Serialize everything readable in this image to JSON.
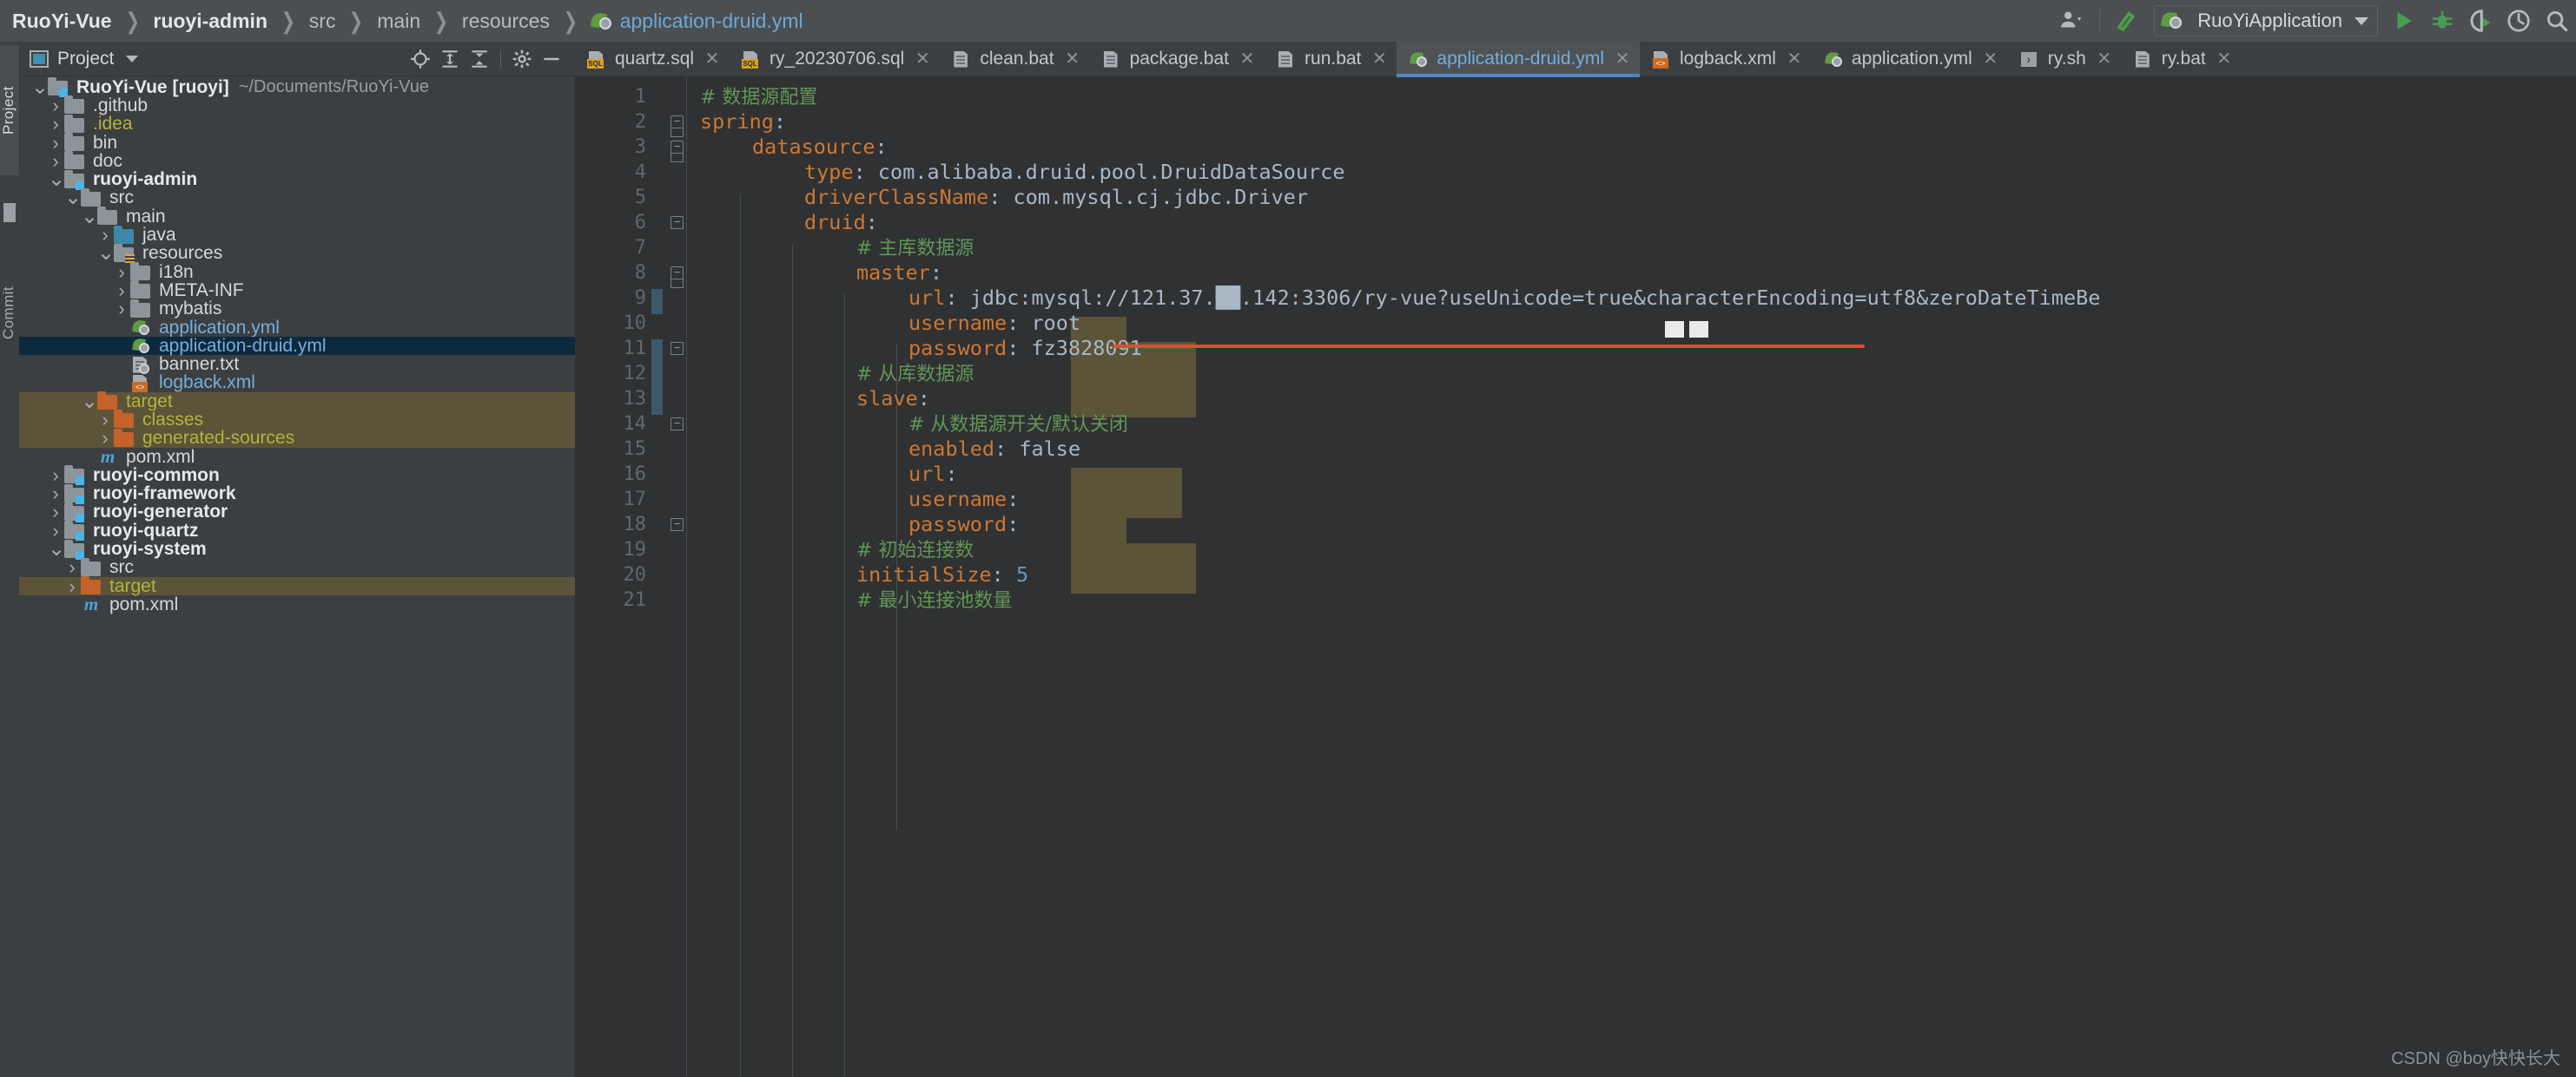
{
  "breadcrumb": {
    "items": [
      {
        "label": "RuoYi-Vue",
        "style": "bold"
      },
      {
        "label": "ruoyi-admin",
        "style": "bold"
      },
      {
        "label": "src",
        "style": "dim"
      },
      {
        "label": "main",
        "style": "dim"
      },
      {
        "label": "resources",
        "style": "dim"
      },
      {
        "label": "application-druid.yml",
        "style": "file"
      }
    ]
  },
  "toolbar": {
    "user_icon": "user-account-icon",
    "build_icon": "build-hammer-icon",
    "run_config_name": "RuoYiApplication",
    "run_icon": "run-play-icon",
    "debug_icon": "debug-bug-icon",
    "run_coverage_icon": "run-with-coverage-icon",
    "profiler_icon": "profiler-icon",
    "search_icon": "search-everywhere-icon",
    "accent_green": "#499c54",
    "accent_blue": "#4a88c7"
  },
  "left_strip": {
    "tabs": [
      "Project",
      "Commit"
    ]
  },
  "project_panel": {
    "title": "Project",
    "actions": [
      "locate-target-icon",
      "expand-all-icon",
      "collapse-all-icon",
      "settings-gear-icon",
      "hide-panel-icon"
    ],
    "tree": [
      {
        "depth": 0,
        "arrow": "down",
        "icon": "module-folder",
        "label": "RuoYi-Vue [ruoyi]",
        "style": "bold",
        "path": "~/Documents/RuoYi-Vue"
      },
      {
        "depth": 1,
        "arrow": "right",
        "icon": "folder",
        "label": ".github",
        "style": "plain"
      },
      {
        "depth": 1,
        "arrow": "right",
        "icon": "folder",
        "label": ".idea",
        "style": "yellow"
      },
      {
        "depth": 1,
        "arrow": "right",
        "icon": "folder",
        "label": "bin",
        "style": "plain"
      },
      {
        "depth": 1,
        "arrow": "right",
        "icon": "folder",
        "label": "doc",
        "style": "plain"
      },
      {
        "depth": 1,
        "arrow": "down",
        "icon": "module-folder",
        "label": "ruoyi-admin",
        "style": "bold"
      },
      {
        "depth": 2,
        "arrow": "down",
        "icon": "folder",
        "label": "src",
        "style": "plain"
      },
      {
        "depth": 3,
        "arrow": "down",
        "icon": "folder",
        "label": "main",
        "style": "plain"
      },
      {
        "depth": 4,
        "arrow": "right",
        "icon": "source-folder",
        "label": "java",
        "style": "plain"
      },
      {
        "depth": 4,
        "arrow": "down",
        "icon": "resource-folder",
        "label": "resources",
        "style": "plain"
      },
      {
        "depth": 5,
        "arrow": "right",
        "icon": "folder",
        "label": "i18n",
        "style": "plain"
      },
      {
        "depth": 5,
        "arrow": "right",
        "icon": "folder",
        "label": "META-INF",
        "style": "plain"
      },
      {
        "depth": 5,
        "arrow": "right",
        "icon": "folder",
        "label": "mybatis",
        "style": "plain"
      },
      {
        "depth": 5,
        "arrow": "none",
        "icon": "spring-yaml-file",
        "label": "application.yml",
        "style": "blue"
      },
      {
        "depth": 5,
        "arrow": "none",
        "icon": "spring-yaml-file",
        "label": "application-druid.yml",
        "style": "blue",
        "selected": true
      },
      {
        "depth": 5,
        "arrow": "none",
        "icon": "banner-txt-file",
        "label": "banner.txt",
        "style": "plain"
      },
      {
        "depth": 5,
        "arrow": "none",
        "icon": "xml-file",
        "label": "logback.xml",
        "style": "blue"
      },
      {
        "depth": 3,
        "arrow": "down",
        "icon": "folder-orange",
        "label": "target",
        "style": "yellow",
        "target_hl": true
      },
      {
        "depth": 4,
        "arrow": "right",
        "icon": "folder-orange",
        "label": "classes",
        "style": "yellow",
        "target_hl": true
      },
      {
        "depth": 4,
        "arrow": "right",
        "icon": "folder-orange",
        "label": "generated-sources",
        "style": "yellow",
        "target_hl": true
      },
      {
        "depth": 3,
        "arrow": "none",
        "icon": "maven-file",
        "label": "pom.xml",
        "style": "plain"
      },
      {
        "depth": 1,
        "arrow": "right",
        "icon": "module-folder",
        "label": "ruoyi-common",
        "style": "bold"
      },
      {
        "depth": 1,
        "arrow": "right",
        "icon": "module-folder",
        "label": "ruoyi-framework",
        "style": "bold"
      },
      {
        "depth": 1,
        "arrow": "right",
        "icon": "module-folder",
        "label": "ruoyi-generator",
        "style": "bold"
      },
      {
        "depth": 1,
        "arrow": "right",
        "icon": "module-folder",
        "label": "ruoyi-quartz",
        "style": "bold"
      },
      {
        "depth": 1,
        "arrow": "down",
        "icon": "module-folder",
        "label": "ruoyi-system",
        "style": "bold"
      },
      {
        "depth": 2,
        "arrow": "right",
        "icon": "folder",
        "label": "src",
        "style": "plain"
      },
      {
        "depth": 2,
        "arrow": "right",
        "icon": "folder-orange",
        "label": "target",
        "style": "yellow",
        "target_hl": true
      },
      {
        "depth": 2,
        "arrow": "none",
        "icon": "maven-file",
        "label": "pom.xml",
        "style": "plain"
      }
    ]
  },
  "editor_tabs": [
    {
      "label": "quartz.sql",
      "icon": "sql-file-icon",
      "active": false
    },
    {
      "label": "ry_20230706.sql",
      "icon": "sql-file-icon",
      "active": false
    },
    {
      "label": "clean.bat",
      "icon": "bat-file-icon",
      "active": false
    },
    {
      "label": "package.bat",
      "icon": "bat-file-icon",
      "active": false
    },
    {
      "label": "run.bat",
      "icon": "bat-file-icon",
      "active": false
    },
    {
      "label": "application-druid.yml",
      "icon": "spring-yaml-file-icon",
      "active": true
    },
    {
      "label": "logback.xml",
      "icon": "xml-file-icon",
      "active": false
    },
    {
      "label": "application.yml",
      "icon": "spring-yaml-file-icon",
      "active": false
    },
    {
      "label": "ry.sh",
      "icon": "shell-file-icon",
      "active": false
    },
    {
      "label": "ry.bat",
      "icon": "bat-file-icon",
      "active": false
    }
  ],
  "editor": {
    "filename": "application-druid.yml",
    "lines": [
      {
        "n": 1,
        "indent": 0,
        "type": "comment",
        "text": "# 数据源配置"
      },
      {
        "n": 2,
        "indent": 0,
        "type": "key",
        "key": "spring",
        "value": ""
      },
      {
        "n": 3,
        "indent": 1,
        "type": "key",
        "key": "datasource",
        "value": ""
      },
      {
        "n": 4,
        "indent": 2,
        "type": "kv",
        "key": "type",
        "value": "com.alibaba.druid.pool.DruidDataSource"
      },
      {
        "n": 5,
        "indent": 2,
        "type": "kv",
        "key": "driverClassName",
        "value": "com.mysql.cj.jdbc.Driver"
      },
      {
        "n": 6,
        "indent": 2,
        "type": "key",
        "key": "druid",
        "value": ""
      },
      {
        "n": 7,
        "indent": 3,
        "type": "comment",
        "text": "# 主库数据源"
      },
      {
        "n": 8,
        "indent": 3,
        "type": "key",
        "key": "master",
        "value": ""
      },
      {
        "n": 9,
        "indent": 4,
        "type": "kv",
        "key": "url",
        "value": "jdbc:mysql://121.37.██.142:3306/ry-vue?useUnicode=true&characterEncoding=utf8&zeroDateTimeBe"
      },
      {
        "n": 10,
        "indent": 4,
        "type": "kv",
        "key": "username",
        "value": "root"
      },
      {
        "n": 11,
        "indent": 4,
        "type": "kv",
        "key": "password",
        "value": "fz3828091"
      },
      {
        "n": 12,
        "indent": 3,
        "type": "comment",
        "text": "# 从库数据源"
      },
      {
        "n": 13,
        "indent": 3,
        "type": "key",
        "key": "slave",
        "value": ""
      },
      {
        "n": 14,
        "indent": 4,
        "type": "comment",
        "text": "# 从数据源开关/默认关闭"
      },
      {
        "n": 15,
        "indent": 4,
        "type": "kv",
        "key": "enabled",
        "value": "false"
      },
      {
        "n": 16,
        "indent": 4,
        "type": "key",
        "key": "url",
        "value": ""
      },
      {
        "n": 17,
        "indent": 4,
        "type": "key",
        "key": "username",
        "value": ""
      },
      {
        "n": 18,
        "indent": 4,
        "type": "key",
        "key": "password",
        "value": ""
      },
      {
        "n": 19,
        "indent": 3,
        "type": "comment",
        "text": "# 初始连接数"
      },
      {
        "n": 20,
        "indent": 3,
        "type": "kvnum",
        "key": "initialSize",
        "value": "5"
      },
      {
        "n": 21,
        "indent": 3,
        "type": "comment",
        "text": "# 最小连接池数量"
      }
    ],
    "colors": {
      "background": "#2f3133",
      "key": "#cc7832",
      "value": "#a9b7c6",
      "comment": "#629755",
      "number": "#6897bb",
      "line_number": "#636769",
      "error_underline": "#e24b34",
      "selection_highlight": "#5b5439"
    },
    "annotations": {
      "error_underline_target": "jdbc:mysql url value",
      "redacted_region": "IP address octets"
    }
  },
  "watermark": "CSDN @boy快快长大"
}
